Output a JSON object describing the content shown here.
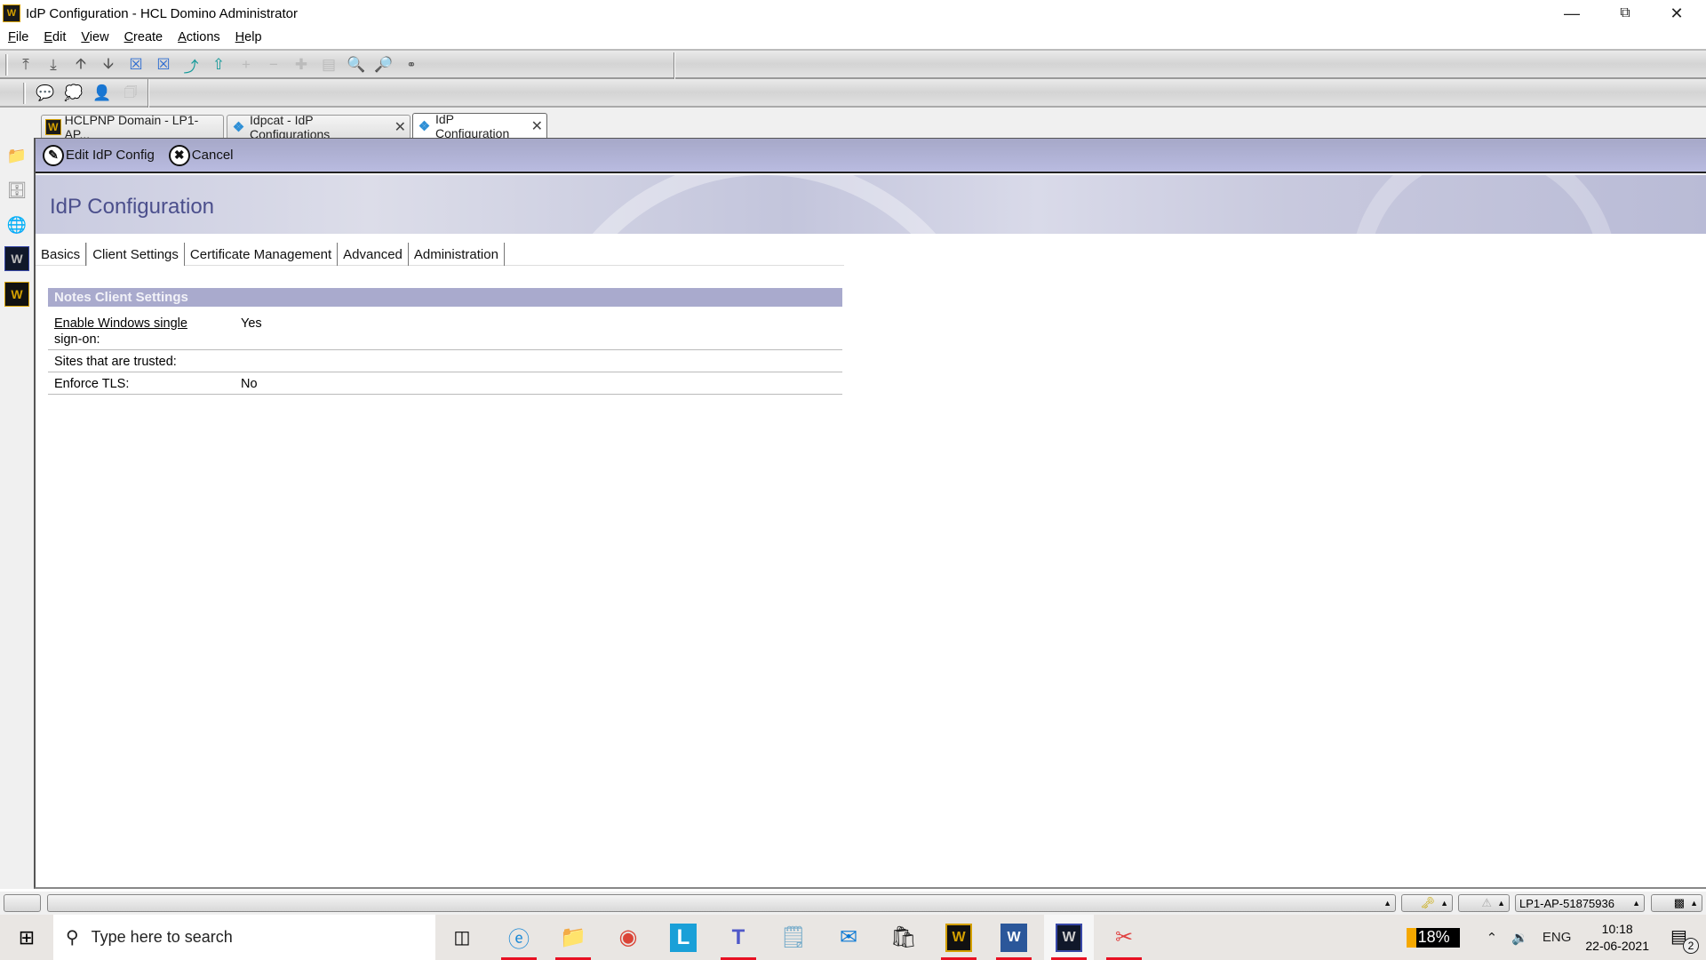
{
  "window": {
    "title": "IdP Configuration - HCL Domino Administrator",
    "minimize_icon": "minimize-icon",
    "restore_icon": "restore-icon",
    "close_icon": "close-icon"
  },
  "menubar": {
    "items": [
      "File",
      "Edit",
      "View",
      "Create",
      "Actions",
      "Help"
    ]
  },
  "toolbar1": {
    "icons": [
      "move-to-top-icon",
      "move-to-bottom-icon",
      "move-up-icon",
      "move-down-icon",
      "next-unread-icon",
      "previous-unread-icon",
      "go-to-parent-icon",
      "go-to-main-icon",
      "expand-icon",
      "collapse-icon",
      "expand-all-icon",
      "collapse-all-icon",
      "search-view-icon",
      "search-icon",
      "link-icon"
    ]
  },
  "toolbar2": {
    "icons": [
      "chat-icon",
      "group-chat-icon",
      "add-contact-icon",
      "contact-card-icon"
    ]
  },
  "tabs": [
    {
      "label": "HCLPNP Domain - LP1-AP...",
      "icon": "domino-icon",
      "closable": false,
      "active": false
    },
    {
      "label": "Idpcat - IdP Configurations",
      "icon": "people-icon",
      "closable": true,
      "active": false
    },
    {
      "label": "IdP Configuration",
      "icon": "people-doc-icon",
      "closable": true,
      "active": true
    }
  ],
  "sidebar": {
    "icons": [
      "bookmarks-folder-icon",
      "server-icon",
      "web-page-icon",
      "domino-admin-icon",
      "domino-designer-icon"
    ]
  },
  "actions": {
    "edit_label": "Edit IdP Config",
    "cancel_label": "Cancel"
  },
  "page": {
    "title": "IdP Configuration"
  },
  "form_tabs": [
    {
      "label": "Basics",
      "active": false
    },
    {
      "label": "Client Settings",
      "active": true
    },
    {
      "label": "Certificate Management",
      "active": false
    },
    {
      "label": "Advanced",
      "active": false
    },
    {
      "label": "Administration",
      "active": false
    }
  ],
  "section": {
    "header": "Notes Client Settings",
    "rows": [
      {
        "label_line1": "Enable Windows single ",
        "label_line2": "sign-on:",
        "value": "Yes"
      },
      {
        "label": "Sites that are trusted:",
        "value": ""
      },
      {
        "label": "Enforce TLS:",
        "value": "No"
      }
    ]
  },
  "statusbar": {
    "location": "LP1-AP-51875936"
  },
  "taskbar": {
    "search_placeholder": "Type here to search",
    "apps": [
      "task-view",
      "edge",
      "file-explorer",
      "chrome",
      "lync",
      "teams",
      "notepad",
      "mail",
      "store",
      "domino-designer",
      "word",
      "domino-admin",
      "snipping-tool"
    ],
    "battery": "18%",
    "language": "ENG",
    "time": "10:18",
    "date": "22-06-2021",
    "notification_count": "2"
  }
}
